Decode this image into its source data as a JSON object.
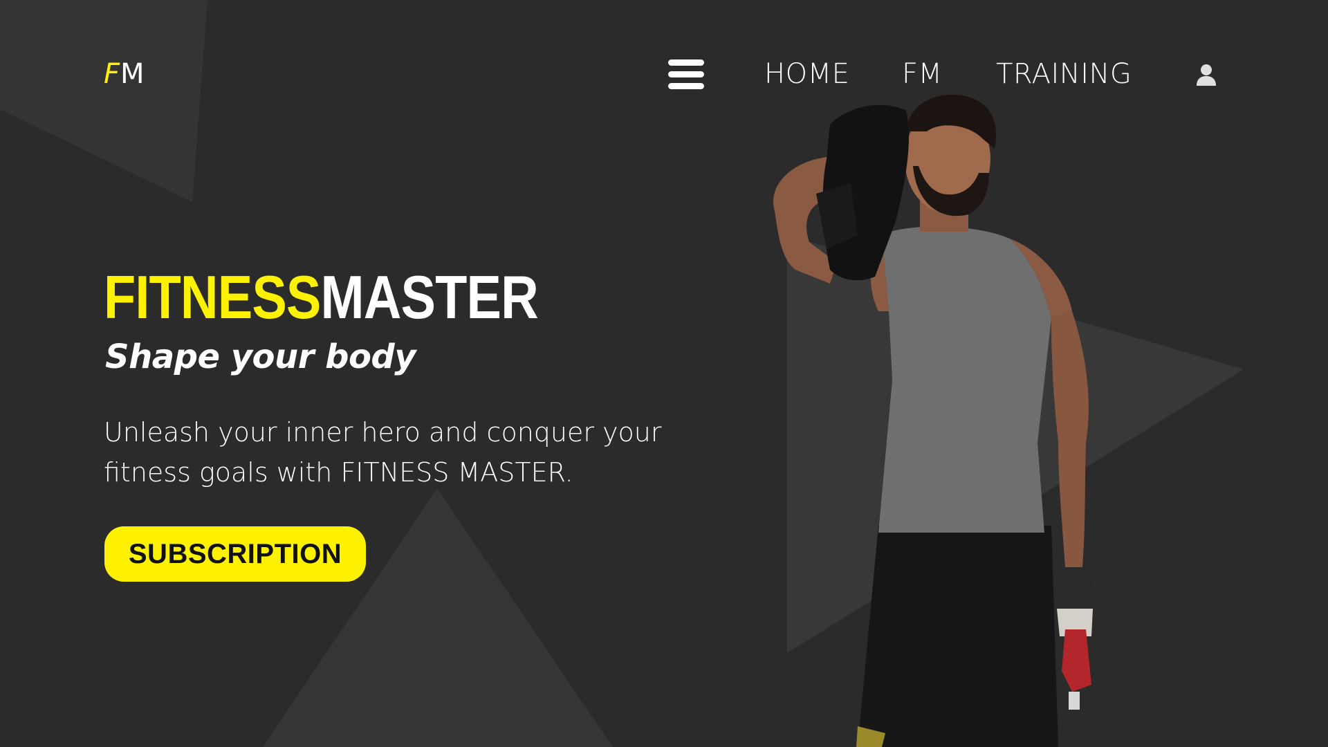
{
  "header": {
    "logo_f": "F",
    "logo_m": "M"
  },
  "nav": {
    "menu_icon": "hamburger-menu-icon",
    "links": [
      "HOME",
      "FM",
      "TRAINING"
    ],
    "user_icon": "user-icon"
  },
  "hero": {
    "title_part1": "FITNESS",
    "title_part2": "MASTER",
    "tagline": "Shape your body",
    "description_line1": "Unleash your inner hero and conquer your",
    "description_line2": "fitness goals with FITNESS MASTER.",
    "cta_label": "SUBSCRIPTION"
  },
  "colors": {
    "background": "#2b2b2b",
    "accent": "#fff200",
    "text": "#ffffff",
    "shape": "#363636"
  }
}
